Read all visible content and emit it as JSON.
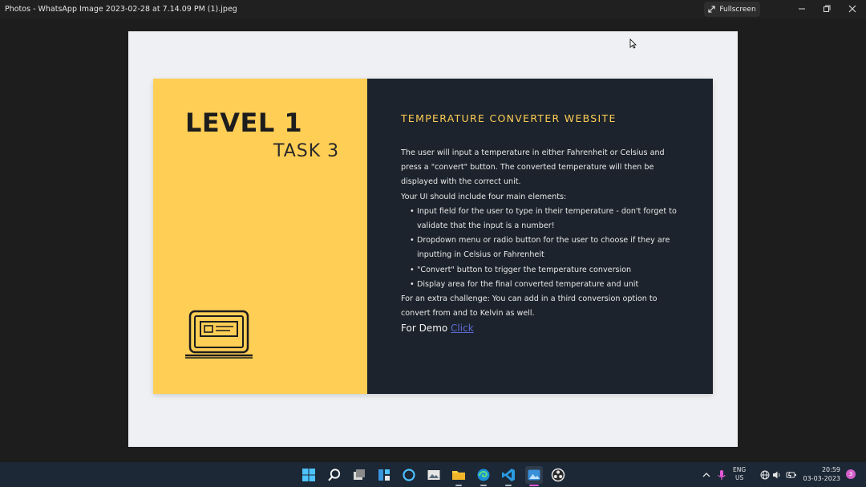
{
  "window": {
    "title": "Photos - WhatsApp Image 2023-02-28 at 7.14.09 PM (1).jpeg",
    "fullscreen_label": "Fullscreen"
  },
  "slide": {
    "level": "LEVEL 1",
    "task": "TASK 3",
    "heading": "TEMPERATURE CONVERTER WEBSITE",
    "intro": "The user will input a temperature in either Fahrenheit or Celsius and press a \"convert\" button. The converted temperature will then be displayed with the correct unit.",
    "ui_intro": "Your UI should include four main elements:",
    "bullets": [
      "Input field for the user to type in their temperature - don't forget to validate that the input is a number!",
      "Dropdown menu or radio button for the user to choose if they are inputting in Celsius or Fahrenheit",
      "\"Convert\" button to trigger the temperature conversion",
      "Display area for the final converted temperature and unit"
    ],
    "challenge": "For an extra challenge: You can add in a third conversion option to convert from and to Kelvin as well.",
    "demo_label": "For Demo",
    "demo_link": "Click"
  },
  "taskbar": {
    "lang_top": "ENG",
    "lang_bottom": "US",
    "time": "20:59",
    "date": "03-03-2023",
    "notification_count": "3"
  },
  "colors": {
    "slide_yellow": "#ffce55",
    "slide_dark": "#1c232c",
    "link": "#5b6bd6"
  }
}
